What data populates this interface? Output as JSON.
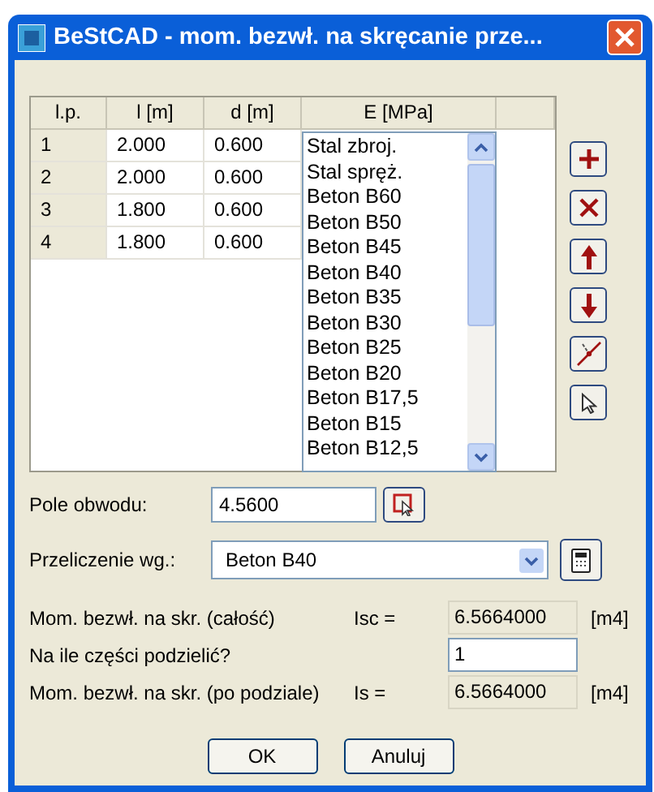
{
  "window": {
    "title": "BeStCAD - mom. bezwł. na skręcanie prze..."
  },
  "table": {
    "columns": [
      "l.p.",
      "l [m]",
      "d [m]",
      "E [MPa]"
    ],
    "rows": [
      {
        "lp": "1",
        "l": "2.000",
        "d": "0.600"
      },
      {
        "lp": "2",
        "l": "2.000",
        "d": "0.600"
      },
      {
        "lp": "3",
        "l": "1.800",
        "d": "0.600"
      },
      {
        "lp": "4",
        "l": "1.800",
        "d": "0.600"
      }
    ]
  },
  "material_list": {
    "items": [
      "Stal zbroj.",
      "Stal spręż.",
      "Beton B60",
      "Beton B50",
      "Beton B45",
      "Beton B40",
      "Beton B35",
      "Beton B30",
      "Beton B25",
      "Beton B20",
      "Beton B17,5",
      "Beton B15",
      "Beton B12,5"
    ]
  },
  "side_buttons": [
    {
      "kind": "add"
    },
    {
      "kind": "delete"
    },
    {
      "kind": "up"
    },
    {
      "kind": "down"
    },
    {
      "kind": "split"
    },
    {
      "kind": "pick"
    }
  ],
  "area": {
    "label": "Pole obwodu:",
    "value": "4.5600"
  },
  "conversion": {
    "label": "Przeliczenie wg.:",
    "value": "Beton B40"
  },
  "results": [
    {
      "kind": "readout",
      "label": "Mom. bezwł. na skr. (całość)",
      "symbol": "Isc =",
      "value": "6.5664000",
      "unit": "[m4]"
    },
    {
      "kind": "input",
      "label": "Na ile części podzielić?",
      "value": "1"
    },
    {
      "kind": "readout",
      "label": "Mom. bezwł. na skr. (po podziale)",
      "symbol": "Is =",
      "value": "6.5664000",
      "unit": "[m4]"
    }
  ],
  "buttons": [
    "OK",
    "Anuluj"
  ]
}
